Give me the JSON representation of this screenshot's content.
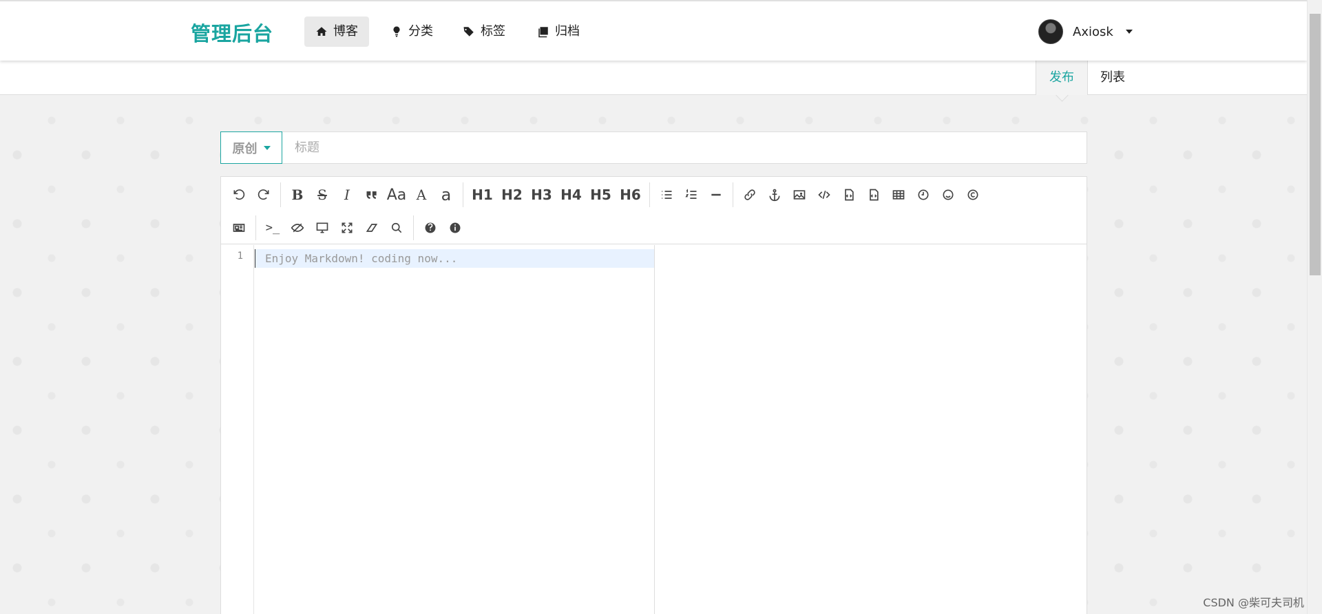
{
  "brand": "管理后台",
  "nav": [
    {
      "label": "博客",
      "icon": "home-icon"
    },
    {
      "label": "分类",
      "icon": "lightbulb-icon"
    },
    {
      "label": "标签",
      "icon": "tags-icon"
    },
    {
      "label": "归档",
      "icon": "archive-icon"
    }
  ],
  "user": {
    "name": "Axiosk"
  },
  "subnav": [
    {
      "label": "发布"
    },
    {
      "label": "列表"
    }
  ],
  "title_row": {
    "type_label": "原创",
    "title_placeholder": "标题"
  },
  "toolbar": {
    "headings": [
      "H1",
      "H2",
      "H3",
      "H4",
      "H5",
      "H6"
    ],
    "ucwords": "Aa",
    "uppercase": "A",
    "lowercase": "a",
    "terminal": ">_"
  },
  "editor": {
    "line_number": "1",
    "placeholder": "Enjoy Markdown! coding now..."
  },
  "watermark": "CSDN @柴可夫司机"
}
